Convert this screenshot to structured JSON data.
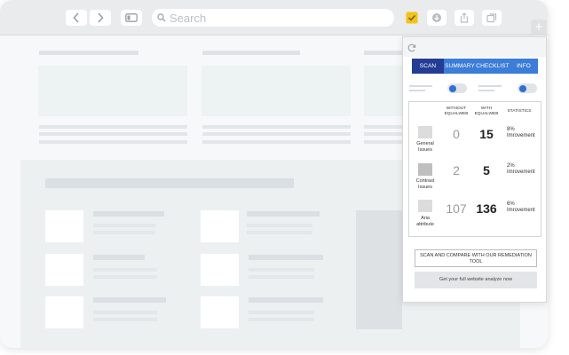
{
  "browser": {
    "search_placeholder": "Search",
    "icons": [
      "chevron-left-icon",
      "chevron-right-icon",
      "sidebar-icon",
      "search-icon",
      "equalweb-extension-icon",
      "download-icon",
      "share-icon",
      "tabs-icon",
      "new-tab-icon"
    ],
    "accent": "#f3c316"
  },
  "extension": {
    "tabs": [
      {
        "label": "SCAN",
        "active": true
      },
      {
        "label": "SUMMARY",
        "active": false
      },
      {
        "label": "CHECKLIST",
        "active": false
      },
      {
        "label": "INFO",
        "active": false
      }
    ],
    "columns": {
      "without": "WITHOUT EQUALWEB",
      "with": "WITH EQUALWEB",
      "statistics": "STATISTICS"
    },
    "rows": [
      {
        "label": "General Issues",
        "without": "0",
        "with": "15",
        "statistics": "8% Imrovement",
        "swatch": "#dcdcdc"
      },
      {
        "label": "Contrast Issues",
        "without": "2",
        "with": "5",
        "statistics": "2% Imrovement",
        "swatch": "#bfbfbf"
      },
      {
        "label": "Aria attribute",
        "without": "107",
        "with": "136",
        "statistics": "6% Imrovement",
        "swatch": "#dcdcdc"
      }
    ],
    "scan_button": "SCAN AND COMPARE WITH OUR REMEDIATION TOOL",
    "analyze_button": "Get your full website analyze now",
    "colors": {
      "tab_bar": "#3b7dd8",
      "tab_active": "#243d94",
      "toggle_knob": "#2f6fd6"
    }
  }
}
